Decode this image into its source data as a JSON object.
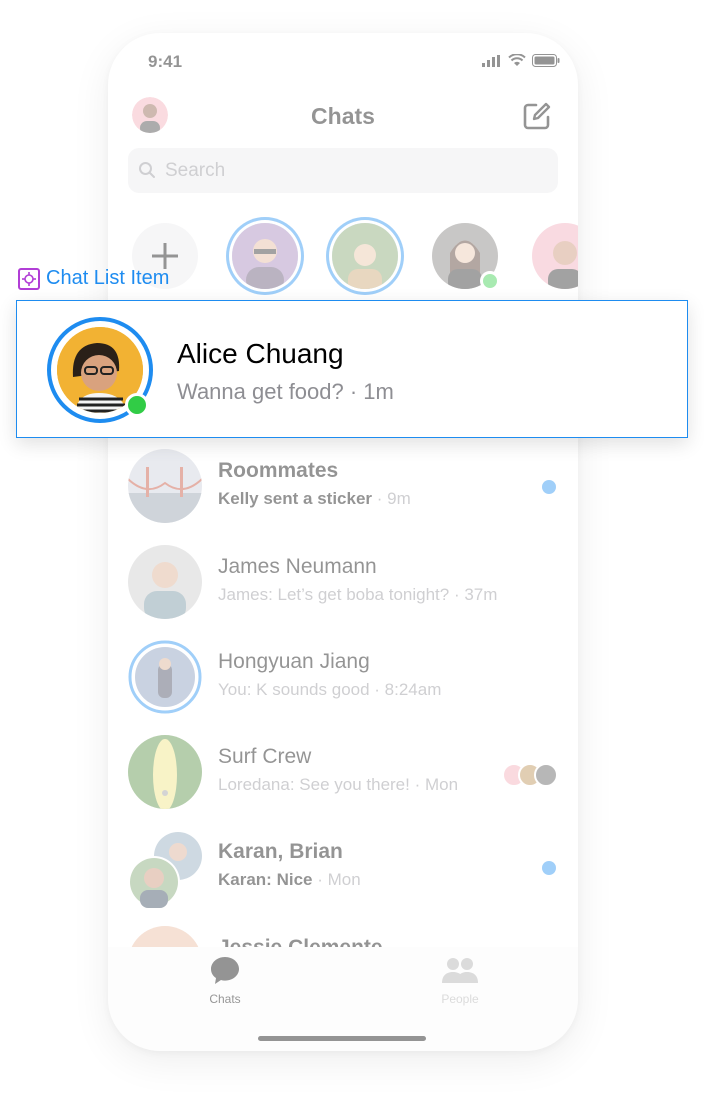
{
  "status_bar": {
    "time": "9:41"
  },
  "header": {
    "title": "Chats"
  },
  "search": {
    "placeholder": "Search"
  },
  "annotation": {
    "label": "Chat List Item"
  },
  "highlighted_chat": {
    "name": "Alice Chuang",
    "message": "Wanna get food? · 1m",
    "online": true
  },
  "chats": [
    {
      "name": "Roommates",
      "sender": "Kelly sent a sticker",
      "time": " · 9m",
      "unread": true
    },
    {
      "name": "James Neumann",
      "message": "James: Let’s get boba tonight? · 37m",
      "unread": false
    },
    {
      "name": "Hongyuan Jiang",
      "message": "You: K sounds good · 8:24am",
      "unread": false
    },
    {
      "name": "Surf Crew",
      "message": "Loredana: See you there! · Mon",
      "unread": false
    },
    {
      "name": "Karan, Brian",
      "sender": "Karan: Nice",
      "time": " · Mon",
      "unread": true
    },
    {
      "name": "Jessie Clemente",
      "message": "",
      "unread": false
    }
  ],
  "tabs": [
    {
      "label": "Chats",
      "active": true
    },
    {
      "label": "People",
      "active": false
    }
  ],
  "colors": {
    "accent": "#1e8cf0",
    "online": "#31cc46",
    "annotation_gear": "#b13ed6"
  }
}
